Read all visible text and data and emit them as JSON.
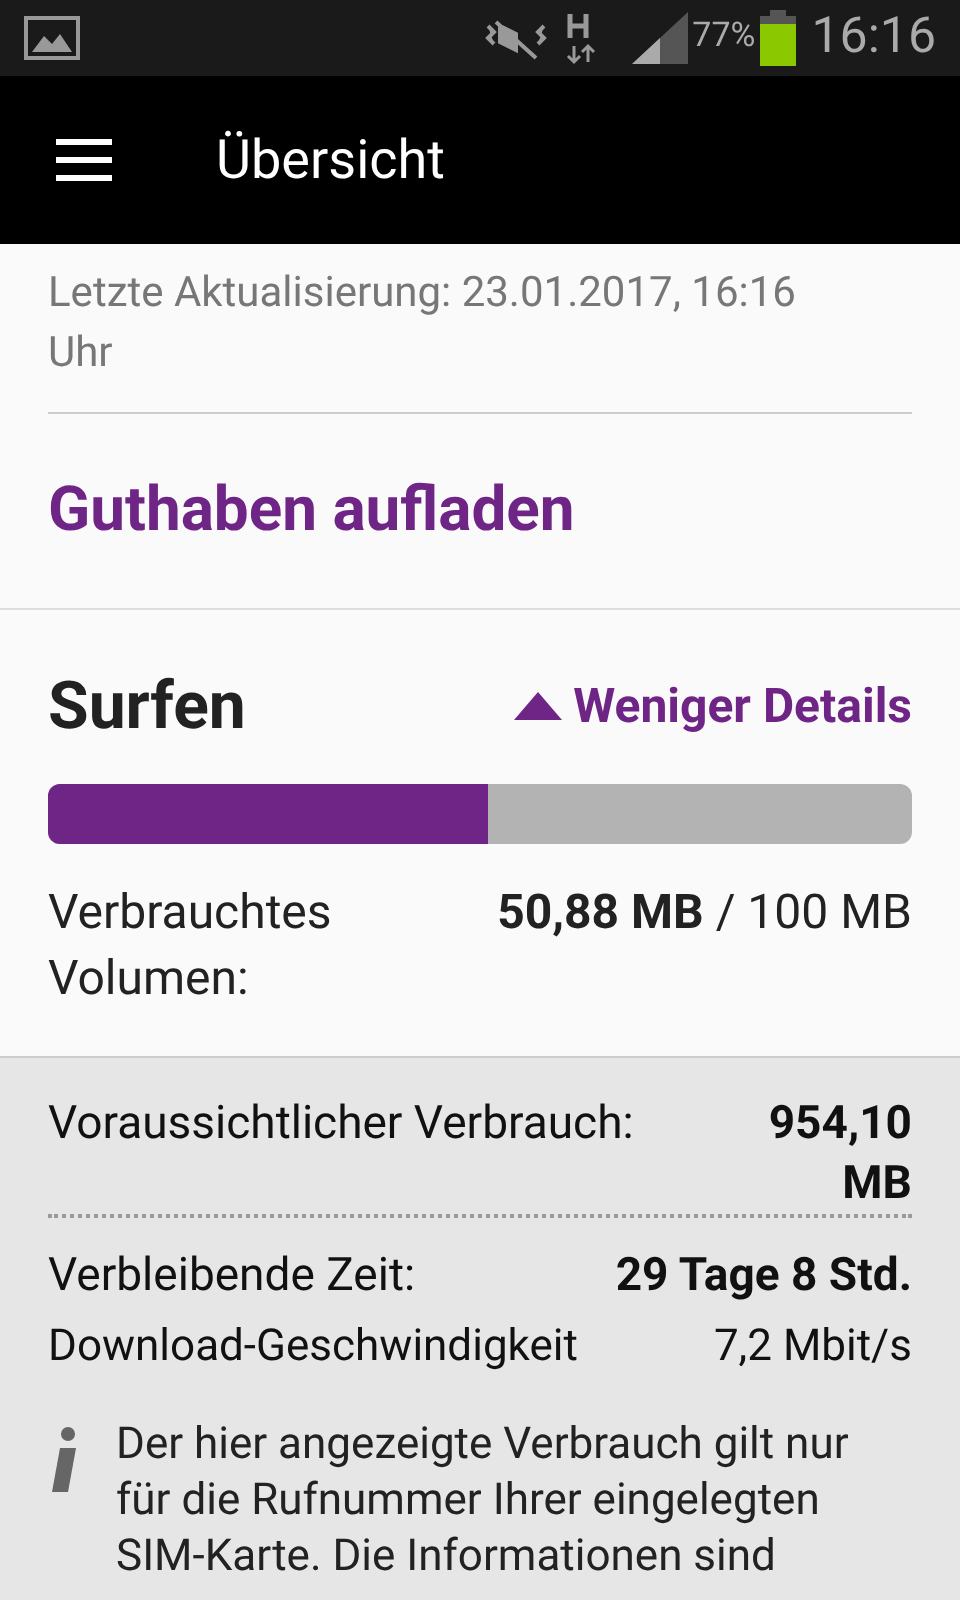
{
  "status_bar": {
    "battery": "77%",
    "time": "16:16"
  },
  "app_bar": {
    "title": "Übersicht"
  },
  "last_update": "Letzte Aktualisierung: 23.01.2017, 16:16 Uhr",
  "top_up_link": "Guthaben aufladen",
  "surfen": {
    "title": "Surfen",
    "details_toggle": {
      "label": "Weniger Details",
      "expanded": true
    },
    "level": 0.5088,
    "used_label": "Verbrauchtes Volumen:",
    "used_value": "50,88 MB",
    "used_total": "/ 100 MB"
  },
  "details": [
    {
      "label": "Voraussichtlicher Verbrauch:",
      "value": "954,10 MB",
      "bold": true,
      "dotted": true
    },
    {
      "label": "Verbleibende Zeit:",
      "value": "29 Tage 8 Std.",
      "bold": true,
      "dotted": false
    },
    {
      "label": "Download-Geschwindigkeit",
      "value": "7,2 Mbit/s",
      "bold": false,
      "dotted": false
    }
  ],
  "info_note": "Der hier angezeigte Verbrauch gilt nur für die Rufnummer Ihrer eingelegten SIM-Karte. Die Informationen sind"
}
